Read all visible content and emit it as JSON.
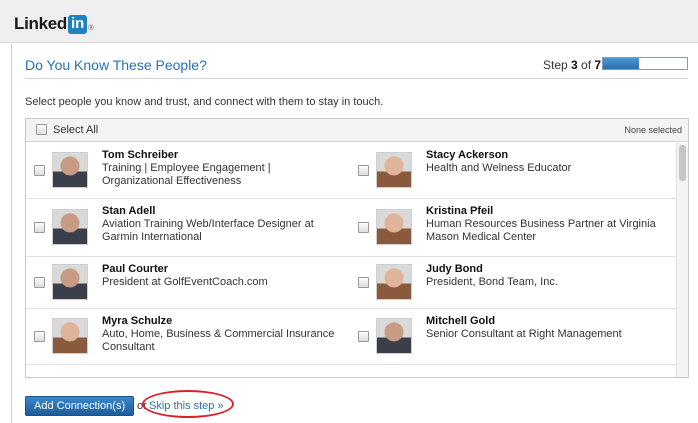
{
  "app": {
    "logo_text": "Linked",
    "logo_in": "in",
    "logo_registered": "®"
  },
  "page": {
    "title": "Do You Know These People?",
    "step_prefix": "Step ",
    "step_current": "3",
    "step_suffix": " of ",
    "step_total": "7",
    "progress_fraction": 0.43,
    "instructions": "Select people you know and trust, and connect with them to stay in touch."
  },
  "list": {
    "select_all_label": "Select All",
    "selection_status": "None selected",
    "people": [
      {
        "name": "Tom Schreiber",
        "title": "Training | Employee Engagement | Organizational Effectiveness",
        "avatar": "avatar-photo-man"
      },
      {
        "name": "Stacy Ackerson",
        "title": "Health and Welness Educator",
        "avatar": "avatar-photo-woman"
      },
      {
        "name": "Stan Adell",
        "title": "Aviation Training Web/Interface Designer at Garmin International",
        "avatar": "avatar-photo-man"
      },
      {
        "name": "Kristina Pfeil",
        "title": "Human Resources Business Partner at Virginia Mason Medical Center",
        "avatar": "avatar-photo-woman"
      },
      {
        "name": "Paul Courter",
        "title": "President at GolfEventCoach.com",
        "avatar": "avatar-photo-man"
      },
      {
        "name": "Judy Bond",
        "title": "President, Bond Team, Inc.",
        "avatar": "avatar-photo-woman"
      },
      {
        "name": "Myra Schulze",
        "title": "Auto, Home, Business & Commercial Insurance Consultant",
        "avatar": "avatar-photo-woman"
      },
      {
        "name": "Mitchell Gold",
        "title": "Senior Consultant at Right Management",
        "avatar": "avatar-photo-man"
      }
    ]
  },
  "actions": {
    "add_connections_label": "Add Connection(s)",
    "or_text": "or",
    "skip_label": "Skip this step »"
  },
  "colors": {
    "link_blue": "#2771b3",
    "brand_blue": "#1f82c0",
    "highlight_red": "#d8232a"
  }
}
